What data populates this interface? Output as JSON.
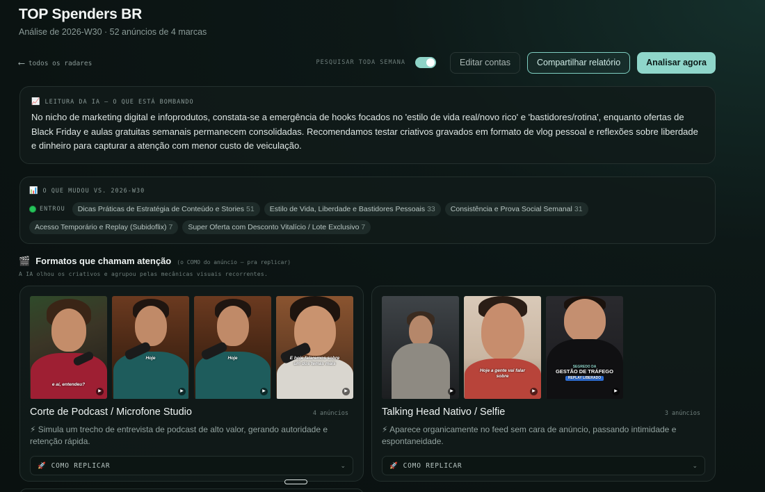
{
  "header": {
    "title": "TOP Spenders BR",
    "subtitle": "Análise de 2026-W30 · 52 anúncios de 4 marcas"
  },
  "nav": {
    "back_arrow": "⟵",
    "back_label": "todos os radares"
  },
  "toolbar": {
    "toggle_label": "PESQUISAR TODA SEMANA",
    "toggle_on": true,
    "edit_label": "Editar contas",
    "share_label": "Compartilhar relatório",
    "analyze_label": "Analisar agora"
  },
  "ai_reading": {
    "icon": "chart-up-icon",
    "label": "LEITURA DA IA — O QUE ESTÁ BOMBANDO",
    "text": "No nicho de marketing digital e infoprodutos, constata-se a emergência de hooks focados no 'estilo de vida real/novo rico' e 'bastidores/rotina', enquanto ofertas de Black Friday e aulas gratuitas semanais permanecem consolidadas. Recomendamos testar criativos gravados em formato de vlog pessoal e reflexões sobre liberdade e dinheiro para capturar a atenção com menor custo de veiculação."
  },
  "changes": {
    "icon": "bar-chart-icon",
    "label": "O QUE MUDOU VS. 2026-W30",
    "entered_label": "ENTROU",
    "chips": [
      {
        "label": "Dicas Práticas de Estratégia de Conteúdo e Stories",
        "count": "51"
      },
      {
        "label": "Estilo de Vida, Liberdade e Bastidores Pessoais",
        "count": "33"
      },
      {
        "label": "Consistência e Prova Social Semanal",
        "count": "31"
      },
      {
        "label": "Acesso Temporário e Replay (Subidoflix)",
        "count": "7"
      },
      {
        "label": "Super Oferta com Desconto Vitalício / Lote Exclusivo",
        "count": "7"
      }
    ]
  },
  "formats": {
    "icon": "clapper-icon",
    "title": "Formatos que chamam atenção",
    "hint": "(o COMO do anúncio — pra replicar)",
    "subtitle": "A IA olhou os criativos e agrupou pelas mecânicas visuais recorrentes.",
    "cards": [
      {
        "name": "Corte de Podcast / Microfone Studio",
        "count": "4 anúncios",
        "desc": "⚡ Simula um trecho de entrevista de podcast de alto valor, gerando autoridade e retenção rápida.",
        "replicate_label": "COMO REPLICAR",
        "captions": [
          "e aí, entendeu?",
          "Hoje",
          "Hoje",
          "E hoje falaremos sobre um dos temas mais"
        ]
      },
      {
        "name": "Talking Head Nativo / Selfie",
        "count": "3 anúncios",
        "desc": "⚡ Aparece organicamente no feed sem cara de anúncio, passando intimidade e espontaneidade.",
        "replicate_label": "COMO REPLICAR",
        "captions": [
          "",
          "Hoje a gente vai falar sobre",
          "GESTÃO DE TRÁFEGO"
        ],
        "thumb3_top": "SEGREDO DA",
        "thumb3_badge": "REPLAY LIBERADO"
      }
    ]
  },
  "colors": {
    "accent": "#8fd6ca",
    "background": "#0b1312",
    "card_border": "#24302e",
    "entered_dot": "#25c45a"
  }
}
